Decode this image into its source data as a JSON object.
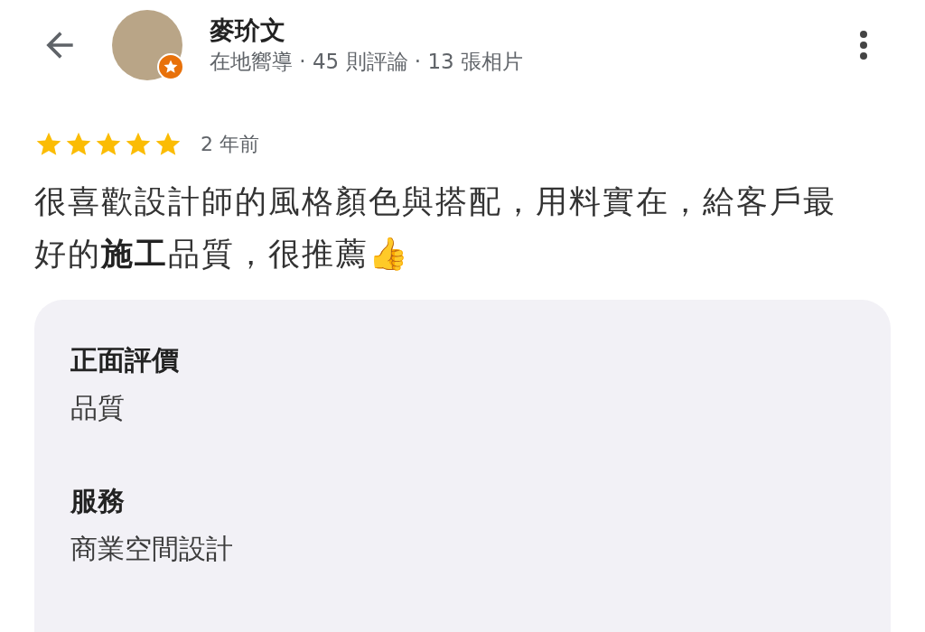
{
  "header": {
    "name": "麥玠文",
    "subtitle": "在地嚮導 · 45 則評論 · 13 張相片"
  },
  "review": {
    "stars": 5,
    "time": "2 年前",
    "text": "很喜歡設計師的風格顏色與搭配，用料實在，給客戶最好的**施工**品質，很推薦👍"
  },
  "details": [
    {
      "label": "正面評價",
      "value": "品質"
    },
    {
      "label": "服務",
      "value": "商業空間設計"
    }
  ]
}
